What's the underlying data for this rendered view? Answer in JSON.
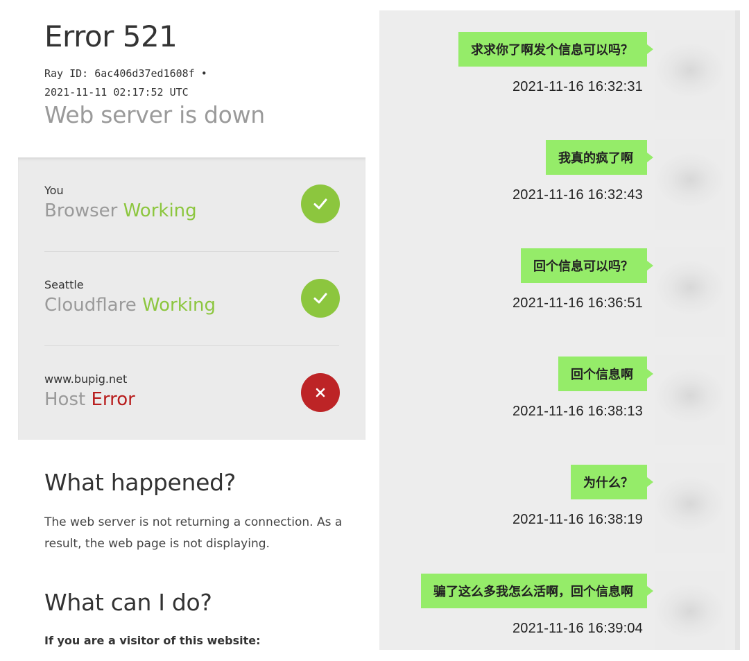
{
  "error_page": {
    "title": "Error 521",
    "ray_line": "Ray ID: 6ac406d37ed1608f •",
    "timestamp_line": "2021-11-11 02:17:52 UTC",
    "subtitle": "Web server is down",
    "rows": [
      {
        "location": "You",
        "component": "Browser",
        "state": "Working",
        "status": "ok",
        "icon": "check-icon"
      },
      {
        "location": "Seattle",
        "component": "Cloudflare",
        "state": "Working",
        "status": "ok",
        "icon": "check-icon"
      },
      {
        "location": "www.bupig.net",
        "component": "Host",
        "state": "Error",
        "status": "error",
        "icon": "cross-icon"
      }
    ],
    "what_happened_heading": "What happened?",
    "what_happened_text": "The web server is not returning a connection. As a result, the web page is not displaying.",
    "what_can_i_do_heading": "What can I do?",
    "visitor_line": "If you are a visitor of this website:",
    "colors": {
      "ok": "#8cc63e",
      "error": "#bd2426"
    }
  },
  "chat": {
    "bubble_color": "#95ec69",
    "messages": [
      {
        "text": "求求你了啊发个信息可以吗？",
        "time": "2021-11-16 16:32:31"
      },
      {
        "text": "我真的疯了啊",
        "time": "2021-11-16 16:32:43"
      },
      {
        "text": "回个信息可以吗？",
        "time": "2021-11-16 16:36:51"
      },
      {
        "text": "回个信息啊",
        "time": "2021-11-16 16:38:13"
      },
      {
        "text": "为什么？",
        "time": "2021-11-16 16:38:19"
      },
      {
        "text": "骗了这么多我怎么活啊，回个信息啊",
        "time": "2021-11-16 16:39:04"
      }
    ]
  }
}
